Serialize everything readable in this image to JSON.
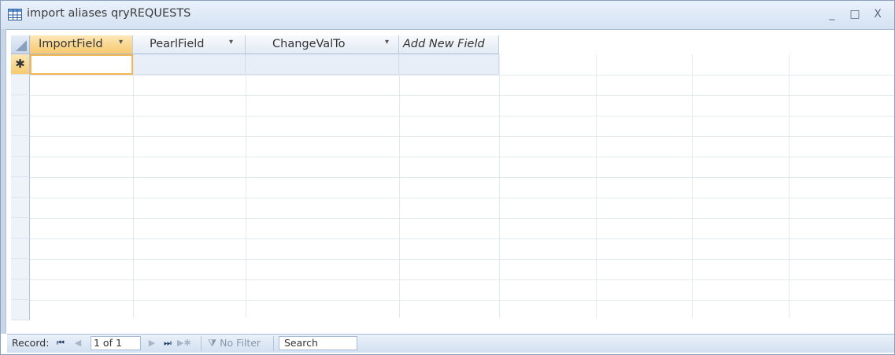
{
  "window": {
    "title": "import aliases qryREQUESTS",
    "icon": "table-icon",
    "controls": [
      "minimize-icon",
      "maximize-icon",
      "close-icon"
    ],
    "controls_glyphs": [
      "_",
      "□",
      "X"
    ]
  },
  "columns": [
    {
      "label": "ImportField",
      "has_dropdown": true,
      "active": true
    },
    {
      "label": "PearlField",
      "has_dropdown": true,
      "active": false
    },
    {
      "label": "ChangeValTo",
      "has_dropdown": true,
      "active": false
    },
    {
      "label": "Add New Field",
      "has_dropdown": false,
      "italic": true
    }
  ],
  "new_row_marker": "✱",
  "rows": [],
  "statusbar": {
    "record_label": "Record:",
    "record_value": "1 of 1",
    "filter_label": "No Filter",
    "search_placeholder": "Search"
  },
  "colors": {
    "accent": "#f7c96f",
    "header_bg": "#e4ebf5",
    "border": "#a9bdd8"
  }
}
